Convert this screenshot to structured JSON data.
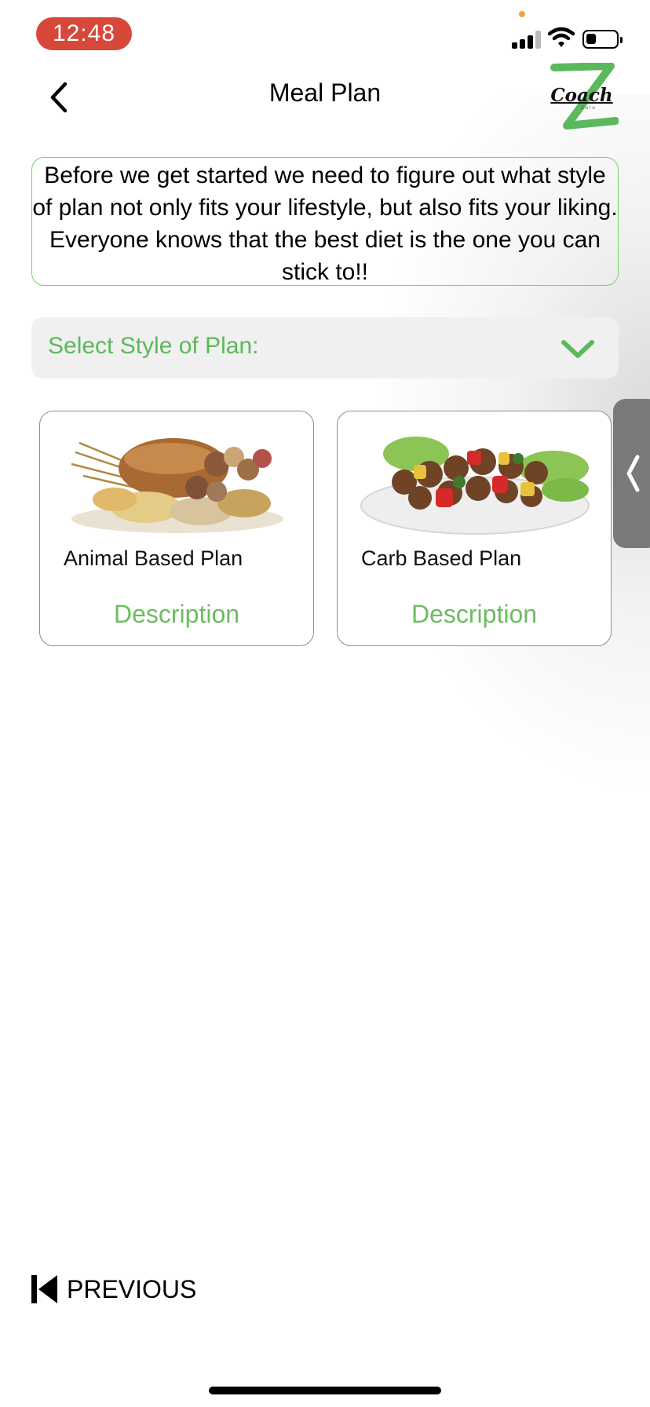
{
  "status_bar": {
    "time": "12:48"
  },
  "nav": {
    "title": "Meal Plan",
    "back_icon": "chevron-left-icon"
  },
  "logo": {
    "text": "Coach",
    "tagline": "Zulu",
    "brand_color": "#5cb85c"
  },
  "intro": {
    "text": "Before we get started we need to figure out what style of plan not only fits your lifestyle, but also fits your liking. Everyone knows that the best diet is the one you can stick to!!"
  },
  "select": {
    "label": "Select Style of Plan:",
    "icon": "chevron-down-icon"
  },
  "cards": [
    {
      "title": "Animal Based Plan",
      "image": "grains-bread-image",
      "link": "Description"
    },
    {
      "title": "Carb Based Plan",
      "image": "meat-kebab-image",
      "link": "Description"
    }
  ],
  "side_tab": {
    "icon": "chevron-left-icon"
  },
  "footer": {
    "previous_label": "PREVIOUS",
    "previous_icon": "skip-back-icon"
  },
  "colors": {
    "accent": "#5cb85c",
    "time_pill": "#d7473a",
    "border_green": "#76d26a",
    "side_tab": "#7a7a7a"
  }
}
